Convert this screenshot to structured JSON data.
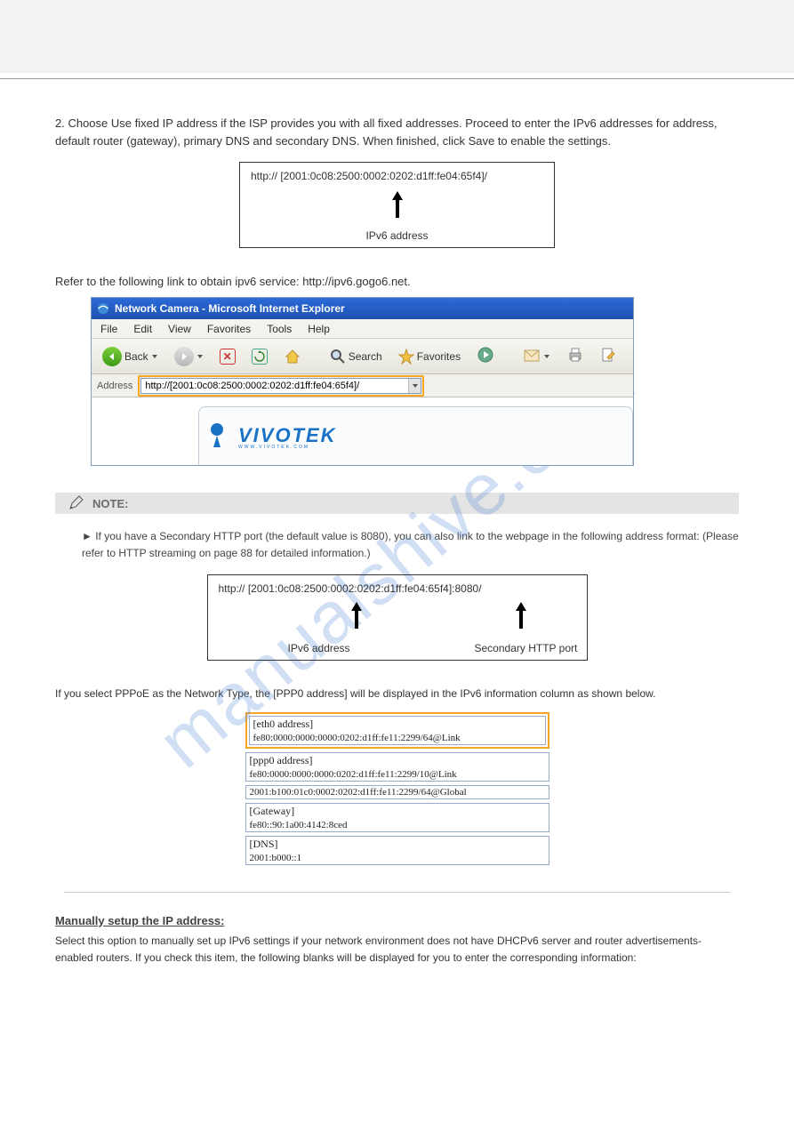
{
  "watermark": "manualshive.com",
  "intro": "2. Choose Use fixed IP address if the ISP provides you with all fixed addresses. Proceed to enter the IPv6 addresses for address, default router (gateway), primary DNS and secondary DNS. When finished, click Save to enable the settings.",
  "urlbox1": {
    "url": "http:// [2001:0c08:2500:0002:0202:d1ff:fe04:65f4]/",
    "arrow_cap": "IPv6 address"
  },
  "refer": "Refer to the following link to obtain ipv6 service: http://ipv6.gogo6.net.",
  "ie": {
    "title": "Network Camera - Microsoft Internet Explorer",
    "menu": {
      "file": "File",
      "edit": "Edit",
      "view": "View",
      "favorites": "Favorites",
      "tools": "Tools",
      "help": "Help"
    },
    "back": "Back",
    "search": "Search",
    "fav": "Favorites",
    "addr_label": "Address",
    "addr_value": "http://[2001:0c08:2500:0002:0202:d1ff:fe04:65f4]/"
  },
  "logo": {
    "brand": "VIVOTEK",
    "sub": "WWW.VIVOTEK.COM"
  },
  "note_label": "NOTE:",
  "notes": [
    "► If you have a Secondary HTTP port (the default value is 8080), you can also link to the webpage in the following address format: (Please refer to HTTP streaming on page 88 for detailed information.)"
  ],
  "urlbox2": {
    "url": "http:// [2001:0c08:2500:0002:0202:d1ff:fe04:65f4]:8080/",
    "cap1": "IPv6 address",
    "cap2": "Secondary HTTP port"
  },
  "after2": "If you select PPPoE as the Network Type, the [PPP0 address] will be displayed in the IPv6 information column as shown below.",
  "params": {
    "eth0_label": "[eth0 address]",
    "eth0_val": "fe80:0000:0000:0000:0202:d1ff:fe11:2299/64@Link",
    "ppp0_label": "[ppp0 address]",
    "ppp0_val1": "fe80:0000:0000:0000:0202:d1ff:fe11:2299/10@Link",
    "ppp0_val2": "2001:b100:01c0:0002:0202:d1ff:fe11:2299/64@Global",
    "gw_label": "[Gateway]",
    "gw_val": "fe80::90:1a00:4142:8ced",
    "dns_label": "[DNS]",
    "dns_val": "2001:b000::1"
  },
  "port_head": "Manually setup the IP address:",
  "port_body": "Select this option to manually set up IPv6 settings if your network environment does not have DHCPv6 server and router advertisements-enabled routers. If you check this item, the following blanks will be displayed for you to enter the corresponding information:"
}
